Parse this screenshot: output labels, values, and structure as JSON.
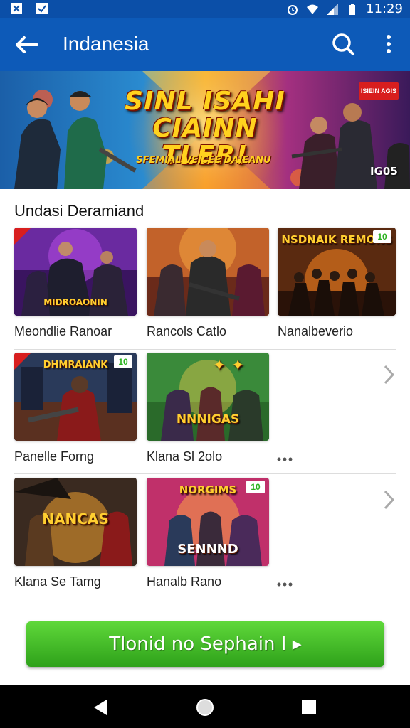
{
  "status_bar": {
    "time": "11:29",
    "icons": [
      "x-box-icon",
      "check-box-icon",
      "alarm-icon",
      "wifi-icon",
      "signal-icon",
      "battery-icon"
    ]
  },
  "app_bar": {
    "title": "Indanesia",
    "color": "#0d5ab8",
    "icons": [
      "back-arrow-icon",
      "search-icon",
      "more-vert-icon"
    ]
  },
  "banner": {
    "title_line1": "SINL ISAHI",
    "title_line2": "CIAINN TLER!",
    "subtitle": "SFEMIAL VEICEE DAIEANU",
    "tag": "ISIEIN AGIS",
    "corner": "IG05"
  },
  "section": {
    "title": "Undasi Deramiand"
  },
  "games": [
    {
      "label": "Meondlie Ranoar",
      "art_text": "MIDROAONIN",
      "badge": "",
      "ribbon": true
    },
    {
      "label": "Rancols Catlo",
      "art_text": "",
      "badge": "",
      "ribbon": false
    },
    {
      "label": "Nanalbeverio",
      "art_text": "NSDNAIK REMONS",
      "badge": "10",
      "ribbon": false
    },
    {
      "label": "Panelle Forng",
      "art_text": "DHMRAIANK",
      "badge": "10",
      "ribbon": true
    },
    {
      "label": "Klana Sl 2olo",
      "art_text": "NNNIGAS",
      "badge": "",
      "ribbon": false
    },
    {
      "label": "Klana Se Tamg",
      "art_text": "NANCAS",
      "badge": "",
      "ribbon": false
    },
    {
      "label": "Hanalb Rano",
      "art_text": "SENNND",
      "badge": "",
      "ribbon": false
    }
  ],
  "cta": {
    "label": "Tlonid no Sephain I ▸",
    "color": "#3fbf24"
  },
  "nav": {
    "icons": [
      "nav-back-icon",
      "nav-home-icon",
      "nav-recents-icon"
    ]
  }
}
